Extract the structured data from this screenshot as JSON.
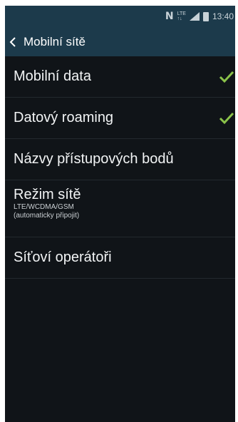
{
  "status_bar": {
    "nfc_label": "N",
    "lte_top": "LTE",
    "lte_bottom": "↑↓",
    "time": "13:40",
    "signal_icon": "signal-icon",
    "battery_icon": "battery-icon"
  },
  "header": {
    "back_icon": "chevron-left-icon",
    "title": "Mobilní sítě"
  },
  "settings": {
    "items": [
      {
        "title": "Mobilní data",
        "checked": true
      },
      {
        "title": "Datový roaming",
        "checked": true
      },
      {
        "title": "Názvy přístupových bodů"
      },
      {
        "title": "Režim sítě",
        "sub1": "LTE/WCDMA/GSM",
        "sub2": "(automaticky připojit)"
      },
      {
        "title": "Síťoví operátoři"
      }
    ]
  },
  "colors": {
    "action_bar": "#1c3a4b",
    "background": "#101418",
    "check_accent": "#8bc34a"
  }
}
